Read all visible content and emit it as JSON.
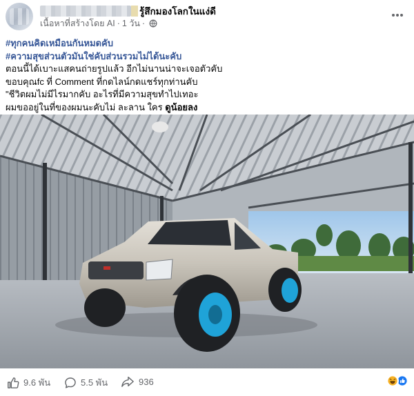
{
  "post": {
    "author_name_obscured": true,
    "feeling_text": "รู้สึกมองโลกในแง่ดี",
    "meta_label": "เนื้อหาที่สร้างโดย AI",
    "time_ago": "1 วัน",
    "privacy_icon": "globe-icon",
    "more_icon": "more-options-icon",
    "hashtags": [
      "#ทุกคนคิดเหมือนกันหมดคับ",
      "#ความสุขส่วนตัวมันใช่คับส่วนรวมไม่ได้นะคับ"
    ],
    "lines": [
      "ตอนนี้ได้เบาะแสคนถ่ายรูปแล้ว อีกไม่นานน่าจะเจอตัวคับ",
      "ขอบคุณfc ที่ Comment ที่กดไลน์กดแชร์ทุกท่านคับ",
      "\"ชีวิตผมไม่มีไรมากคับ อะไรที่มีความสุขทำไปเทอะ"
    ],
    "last_line_prefix": "ผมขออยู่ในที่ของผมนะคับไม่ ละลาน ใคร ",
    "last_line_bold": "ดูน้อยลง"
  },
  "footer": {
    "likes": "9.6 พัน",
    "comments": "5.5 พัน",
    "shares": "936",
    "reaction_colors": {
      "haha": "#f7b125",
      "like": "#1877f2"
    }
  },
  "colors": {
    "hashtag": "#385898",
    "secondary_text": "#65676b",
    "truck_body": "#c9c4ba",
    "wheel_rim": "#1fa3d8"
  }
}
